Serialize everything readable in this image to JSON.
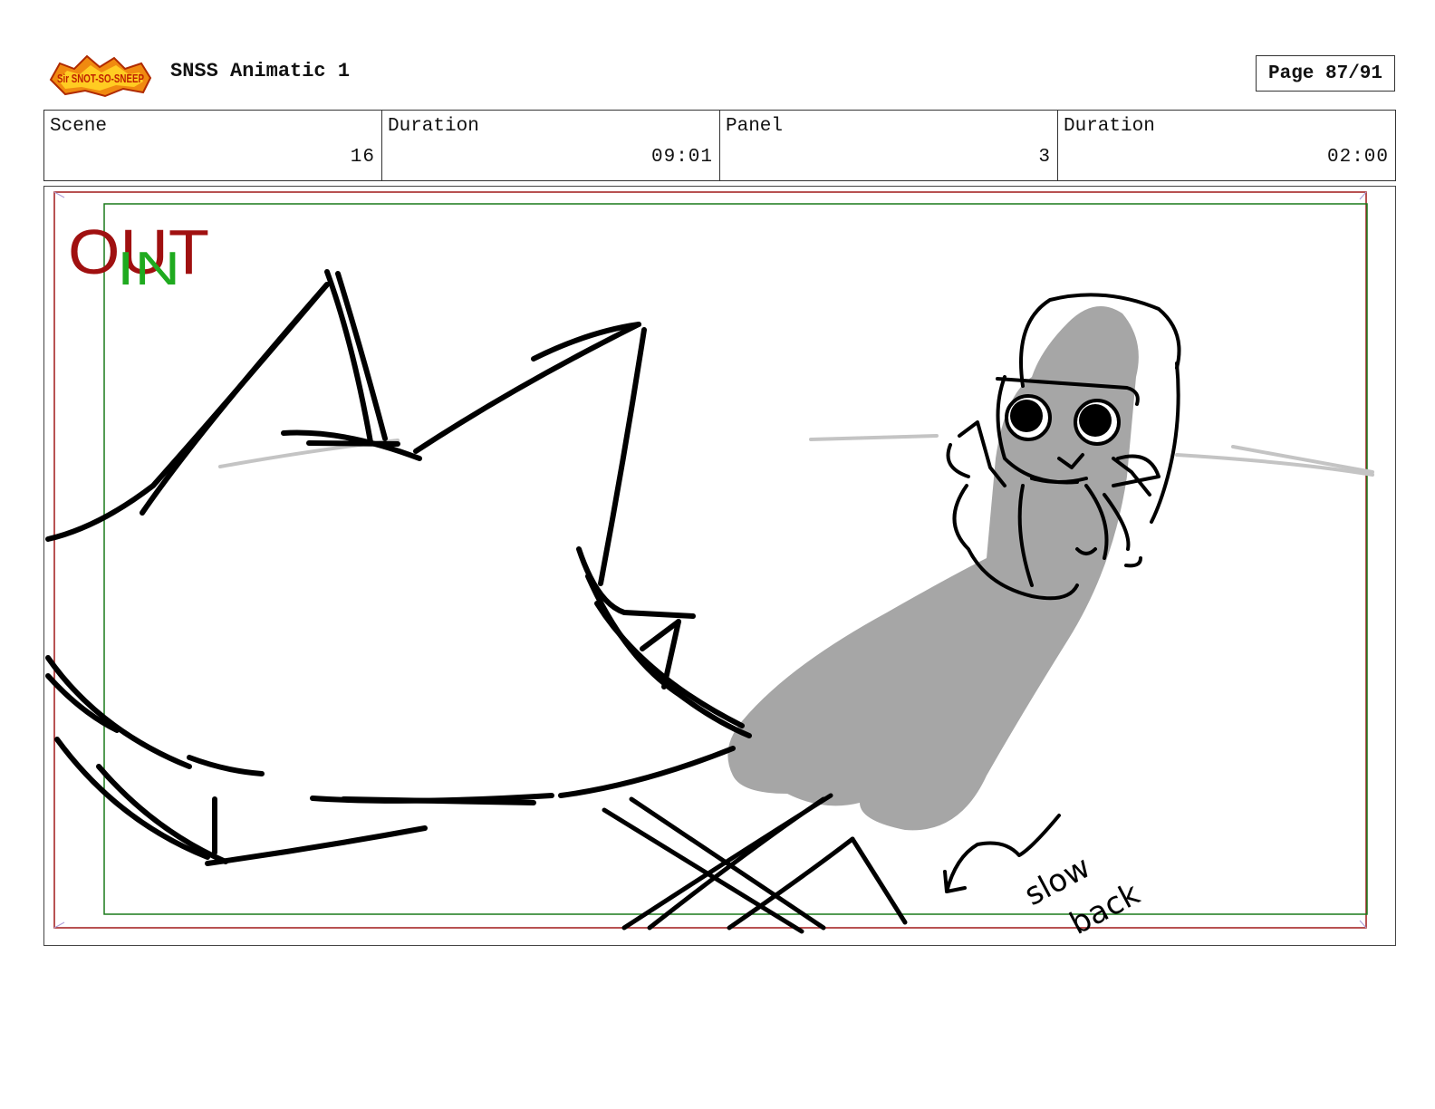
{
  "header": {
    "logo_text": "Sir SNOT-SO-SNEEP",
    "title": "SNSS Animatic 1",
    "page": "Page 87/91"
  },
  "info": {
    "scene_label": "Scene",
    "scene_value": "16",
    "scene_duration_label": "Duration",
    "scene_duration_value": "09:01",
    "panel_label": "Panel",
    "panel_value": "3",
    "panel_duration_label": "Duration",
    "panel_duration_value": "02:00"
  },
  "panel": {
    "out_label": "OUT",
    "in_label": "IN",
    "note_line1": "slow",
    "note_line2": "back",
    "colors": {
      "out_frame": "#a01818",
      "in_frame": "#1a7a1a",
      "out_text": "#a01010",
      "in_text": "#1faa1f",
      "shadow": "#a6a6a6",
      "ink": "#000000"
    }
  }
}
